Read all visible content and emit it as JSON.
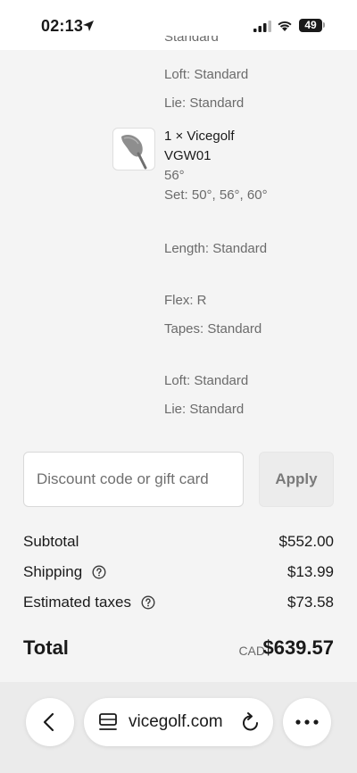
{
  "status_bar": {
    "time": "02:13",
    "battery": "49"
  },
  "items": {
    "prev_item": {
      "clipped_attr": "Standard",
      "loft": "Loft: Standard",
      "lie": "Lie: Standard"
    },
    "product": {
      "name": "1 × Vicegolf VGW01",
      "variant": "56°",
      "set": "Set: 50°, 56°, 60°",
      "length": "Length: Standard",
      "flex": "Flex: R",
      "tapes": "Tapes: Standard",
      "loft": "Loft: Standard",
      "lie": "Lie: Standard"
    }
  },
  "discount": {
    "placeholder": "Discount code or gift card",
    "apply_label": "Apply"
  },
  "summary": {
    "subtotal_label": "Subtotal",
    "subtotal_value": "$552.00",
    "shipping_label": "Shipping",
    "shipping_value": "$13.99",
    "taxes_label": "Estimated taxes",
    "taxes_value": "$73.58",
    "total_label": "Total",
    "currency": "CAD",
    "total_value": "$639.57"
  },
  "browser": {
    "url": "vicegolf.com"
  },
  "icons": {
    "location": "location-arrow-icon",
    "signal": "cellular-signal-icon",
    "wifi": "wifi-icon",
    "help": "question-circle-icon",
    "back": "chevron-left-icon",
    "tabs": "tabs-icon",
    "reload": "reload-icon",
    "more": "more-horizontal-icon"
  }
}
